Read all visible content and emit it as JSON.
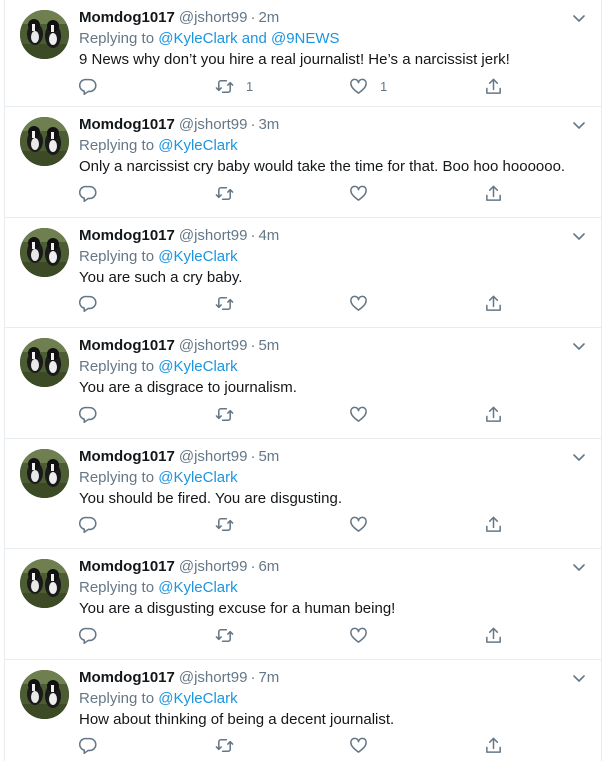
{
  "tweets": [
    {
      "display_name": "Momdog1017",
      "handle": "@jshort99",
      "separator": "·",
      "time": "2m",
      "replying_prefix": "Replying to",
      "replying_to": "@KyleClark and @9NEWS",
      "text": "9 News why don’t you hire a real journalist!  He’s a narcissist jerk!",
      "retweet_count": "1",
      "like_count": "1"
    },
    {
      "display_name": "Momdog1017",
      "handle": "@jshort99",
      "separator": "·",
      "time": "3m",
      "replying_prefix": "Replying to",
      "replying_to": "@KyleClark",
      "text": "Only a narcissist cry baby would take the time for that. Boo hoo hoooooo.",
      "retweet_count": "",
      "like_count": ""
    },
    {
      "display_name": "Momdog1017",
      "handle": "@jshort99",
      "separator": "·",
      "time": "4m",
      "replying_prefix": "Replying to",
      "replying_to": "@KyleClark",
      "text": "You are such a cry baby.",
      "retweet_count": "",
      "like_count": ""
    },
    {
      "display_name": "Momdog1017",
      "handle": "@jshort99",
      "separator": "·",
      "time": "5m",
      "replying_prefix": "Replying to",
      "replying_to": "@KyleClark",
      "text": "You are a disgrace to journalism.",
      "retweet_count": "",
      "like_count": ""
    },
    {
      "display_name": "Momdog1017",
      "handle": "@jshort99",
      "separator": "·",
      "time": "5m",
      "replying_prefix": "Replying to",
      "replying_to": "@KyleClark",
      "text": "You should be fired.  You are disgusting.",
      "retweet_count": "",
      "like_count": ""
    },
    {
      "display_name": "Momdog1017",
      "handle": "@jshort99",
      "separator": "·",
      "time": "6m",
      "replying_prefix": "Replying to",
      "replying_to": "@KyleClark",
      "text": "You are a disgusting excuse for a human being!",
      "retweet_count": "",
      "like_count": ""
    },
    {
      "display_name": "Momdog1017",
      "handle": "@jshort99",
      "separator": "·",
      "time": "7m",
      "replying_prefix": "Replying to",
      "replying_to": "@KyleClark",
      "text": "How about thinking of being a decent journalist.",
      "retweet_count": "",
      "like_count": ""
    }
  ],
  "icons": {
    "reply": "reply-icon",
    "retweet": "retweet-icon",
    "like": "heart-icon",
    "share": "share-icon",
    "menu": "chevron-down-icon",
    "avatar": "dog-avatar"
  },
  "colors": {
    "link": "#1b95e0",
    "text": "#14171a",
    "muted": "#657786",
    "border": "#e6ecf0"
  }
}
